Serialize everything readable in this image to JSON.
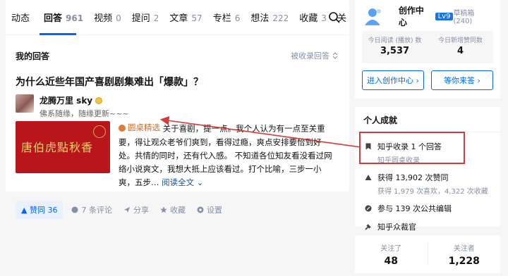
{
  "tabs": [
    {
      "label": "动态",
      "count": ""
    },
    {
      "label": "回答",
      "count": "961"
    },
    {
      "label": "视频",
      "count": "0"
    },
    {
      "label": "提问",
      "count": "2"
    },
    {
      "label": "文章",
      "count": "57"
    },
    {
      "label": "专栏",
      "count": "6"
    },
    {
      "label": "想法",
      "count": "222"
    },
    {
      "label": "收藏",
      "count": "3"
    },
    {
      "label": "关",
      "count": ""
    }
  ],
  "answers_section": {
    "title": "我的回答",
    "sort_label": "被收录回答"
  },
  "answer": {
    "question": "为什么近些年国产喜剧剧集难出「爆款」？",
    "author_name": "龙腾万里 sky",
    "author_bio": "佛系随缘，随缘更新~~~",
    "thumb_text": "唐伯虎點秋香",
    "pick_tag": "圆桌精选",
    "excerpt": "关于喜剧，提一点。我个人认为有一点至关重要，得让观众老爷们爽到，看得过瘾，爽点安排要恰到好处。共情的同时，还有代入感。 不知道各位知友看没看过网络小说爽文，我想大抵上应该看过。打个比喻，三步一小爽，五步…",
    "read_more": "阅读全文",
    "vote_label": "▲ 赞同 36",
    "comments_label": "7 条评论",
    "share_label": "分享",
    "collect_label": "收藏",
    "settings_label": "设置"
  },
  "creator": {
    "title": "创作中心",
    "level": "Lv9",
    "drafts": "草稿箱(240)",
    "stats": [
      {
        "label": "今日阅读 (播放) 数",
        "value": "3,537"
      },
      {
        "label": "今日新增赞同数",
        "value": "4"
      }
    ],
    "enter_button": "进入创作中心 ›",
    "answer_button": "等你来答 ›"
  },
  "achievements": {
    "title": "个人成就",
    "collected": "知乎收录 1 个回答",
    "collected_sub": "知乎圆桌收录",
    "votes": "获得 13,902 次赞同",
    "votes_sub": "获得 1,979 次喜欢，4,322 次收藏",
    "edits": "参与 139 次公共编辑",
    "role": "知乎众裁官"
  },
  "follow": {
    "following_label": "关注了",
    "following_value": "48",
    "followers_label": "关注者",
    "followers_value": "1,228"
  },
  "colors": {
    "accent": "#0066ff",
    "highlight_box": "#d83a3a",
    "thumb_bg": "#b8161b"
  }
}
